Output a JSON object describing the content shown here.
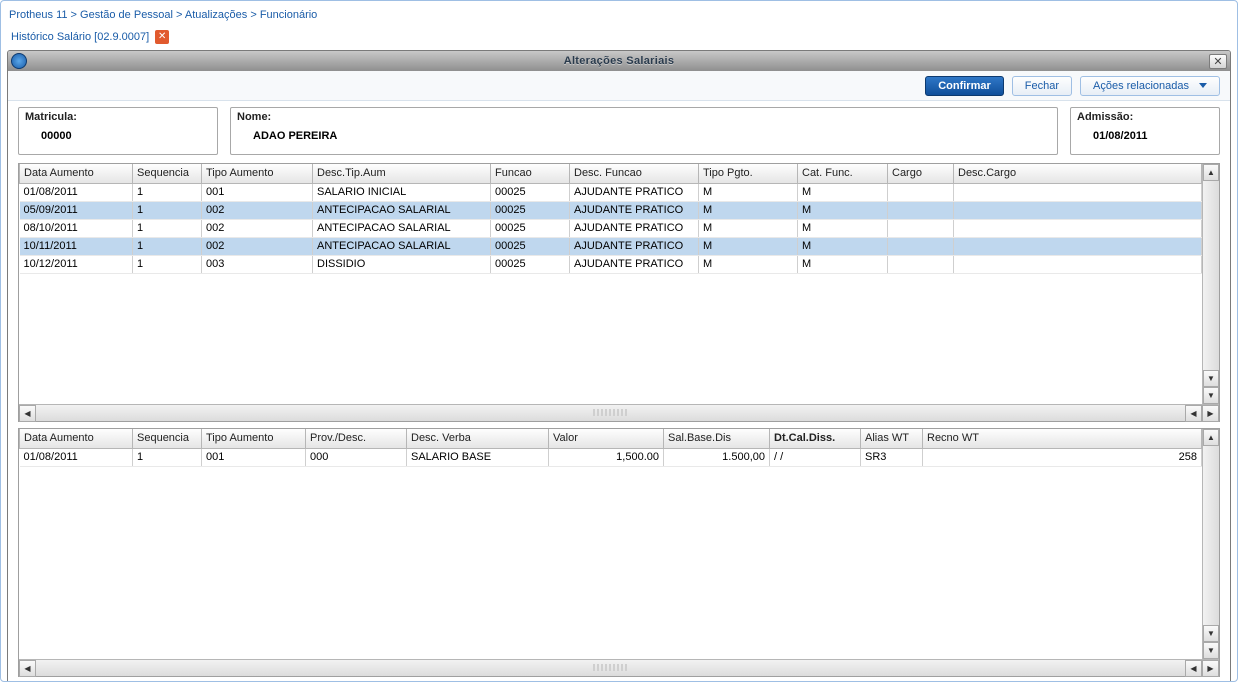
{
  "breadcrumb": "Protheus 11 > Gestão de Pessoal > Atualizações > Funcionário",
  "tab": {
    "label": "Histórico Salário [02.9.0007]"
  },
  "panel": {
    "title": "Alterações Salariais",
    "toolbar": {
      "confirm": "Confirmar",
      "close": "Fechar",
      "actions": "Ações relacionadas"
    }
  },
  "form": {
    "matricula_label": "Matricula:",
    "matricula": "00000",
    "nome_label": "Nome:",
    "nome": "ADAO PEREIRA",
    "admissao_label": "Admissão:",
    "admissao": "01/08/2011"
  },
  "grid1": {
    "headers": [
      "Data Aumento",
      "Sequencia",
      "Tipo Aumento",
      "Desc.Tip.Aum",
      "Funcao",
      "Desc. Funcao",
      "Tipo Pgto.",
      "Cat. Func.",
      "Cargo",
      "Desc.Cargo"
    ],
    "rows": [
      {
        "data": "01/08/2011",
        "seq": "1",
        "tipo": "001",
        "desc_tipo": "SALARIO INICIAL",
        "func": "00025",
        "desc_func": "AJUDANTE PRATICO",
        "pgto": "M",
        "cat": "M",
        "cargo": "",
        "desc_cargo": ""
      },
      {
        "data": "05/09/2011",
        "seq": "1",
        "tipo": "002",
        "desc_tipo": "ANTECIPACAO SALARIAL",
        "func": "00025",
        "desc_func": "AJUDANTE PRATICO",
        "pgto": "M",
        "cat": "M",
        "cargo": "",
        "desc_cargo": ""
      },
      {
        "data": "08/10/2011",
        "seq": "1",
        "tipo": "002",
        "desc_tipo": "ANTECIPACAO SALARIAL",
        "func": "00025",
        "desc_func": "AJUDANTE PRATICO",
        "pgto": "M",
        "cat": "M",
        "cargo": "",
        "desc_cargo": ""
      },
      {
        "data": "10/11/2011",
        "seq": "1",
        "tipo": "002",
        "desc_tipo": "ANTECIPACAO SALARIAL",
        "func": "00025",
        "desc_func": "AJUDANTE PRATICO",
        "pgto": "M",
        "cat": "M",
        "cargo": "",
        "desc_cargo": ""
      },
      {
        "data": "10/12/2011",
        "seq": "1",
        "tipo": "003",
        "desc_tipo": "DISSIDIO",
        "func": "00025",
        "desc_func": "AJUDANTE PRATICO",
        "pgto": "M",
        "cat": "M",
        "cargo": "",
        "desc_cargo": ""
      }
    ]
  },
  "grid2": {
    "headers": [
      "Data Aumento",
      "Sequencia",
      "Tipo Aumento",
      "Prov./Desc.",
      "Desc. Verba",
      "Valor",
      "Sal.Base.Dis",
      "Dt.Cal.Diss.",
      "Alias WT",
      "Recno WT"
    ],
    "sorted_col": 7,
    "rows": [
      {
        "data": "01/08/2011",
        "seq": "1",
        "tipo": "001",
        "prov": "000",
        "verba": "SALARIO BASE",
        "valor": "1,500.00",
        "sal": "1.500,00",
        "dtcal": "/   /",
        "alias": "SR3",
        "recno": "258"
      }
    ]
  }
}
